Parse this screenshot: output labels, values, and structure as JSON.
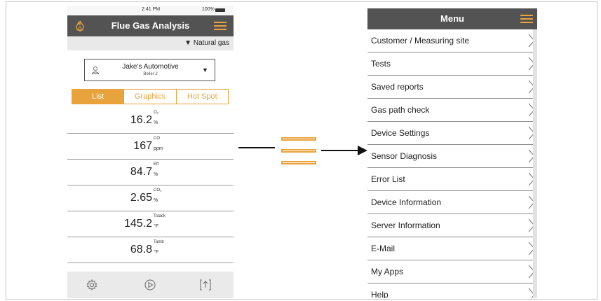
{
  "left_phone": {
    "status": {
      "time": "2:41 PM",
      "battery": "100%"
    },
    "title": "Flue Gas Analysis",
    "fuel": "▼ Natural gas",
    "customer": {
      "name": "Jake's Automotive",
      "sub": "Boiler 2",
      "dropdown_glyph": "▼"
    },
    "tabs": [
      {
        "label": "List",
        "active": true
      },
      {
        "label": "Graphics",
        "active": false
      },
      {
        "label": "Hot Spot",
        "active": false
      }
    ],
    "readings": [
      {
        "value": "16.2",
        "param": "O₂",
        "unit": "%"
      },
      {
        "value": "167",
        "param": "CO",
        "unit": "ppm"
      },
      {
        "value": "84.7",
        "param": "Eff",
        "unit": "%"
      },
      {
        "value": "2.65",
        "param": "CO₂",
        "unit": "%"
      },
      {
        "value": "145.2",
        "param": "Tstack",
        "unit": "°F"
      },
      {
        "value": "68.8",
        "param": "Tamb",
        "unit": "°F"
      }
    ],
    "bottom_icons": [
      "gear-icon",
      "play-icon",
      "export-icon"
    ]
  },
  "right_menu": {
    "title": "Menu",
    "items": [
      "Customer / Measuring site",
      "Tests",
      "Saved reports",
      "Gas path check",
      "Device Settings",
      "Sensor Diagnosis",
      "Error List",
      "Device Information",
      "Server Information",
      "E-Mail",
      "My Apps",
      "Help"
    ]
  },
  "colors": {
    "accent": "#e8a33c",
    "header": "#535353"
  }
}
